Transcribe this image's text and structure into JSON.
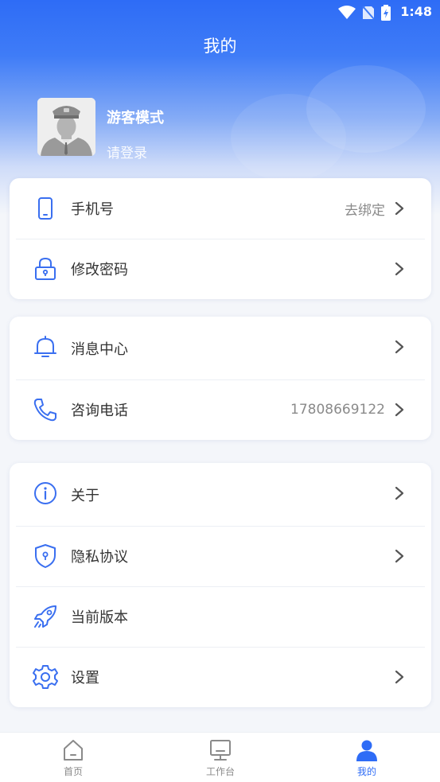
{
  "status_bar": {
    "time": "1:48",
    "icons": [
      "wifi-icon",
      "no-sim-icon",
      "battery-charging-icon"
    ]
  },
  "header": {
    "title": "我的"
  },
  "profile": {
    "name": "游客模式",
    "hint": "请登录",
    "avatar_icon": "user-avatar"
  },
  "groups": [
    {
      "items": [
        {
          "icon": "phone-icon",
          "label": "手机号",
          "value": "去绑定",
          "chevron": true
        },
        {
          "icon": "lock-icon",
          "label": "修改密码",
          "value": "",
          "chevron": true
        }
      ]
    },
    {
      "items": [
        {
          "icon": "bell-icon",
          "label": "消息中心",
          "value": "",
          "chevron": true
        },
        {
          "icon": "telephone-icon",
          "label": "咨询电话",
          "value": "17808669122",
          "chevron": true
        }
      ]
    },
    {
      "items": [
        {
          "icon": "info-icon",
          "label": "关于",
          "value": "",
          "chevron": true
        },
        {
          "icon": "shield-icon",
          "label": "隐私协议",
          "value": "",
          "chevron": true
        },
        {
          "icon": "rocket-icon",
          "label": "当前版本",
          "value": "",
          "chevron": false
        },
        {
          "icon": "gear-icon",
          "label": "设置",
          "value": "",
          "chevron": true
        }
      ]
    }
  ],
  "tabbar": {
    "tabs": [
      {
        "icon": "home-icon",
        "label": "首页",
        "active": false
      },
      {
        "icon": "monitor-icon",
        "label": "工作台",
        "active": false
      },
      {
        "icon": "person-icon",
        "label": "我的",
        "active": true
      }
    ]
  },
  "colors": {
    "accent": "#2e6cf6",
    "icon_blue": "#3a6ff0",
    "muted_text": "#8a8a8a"
  }
}
